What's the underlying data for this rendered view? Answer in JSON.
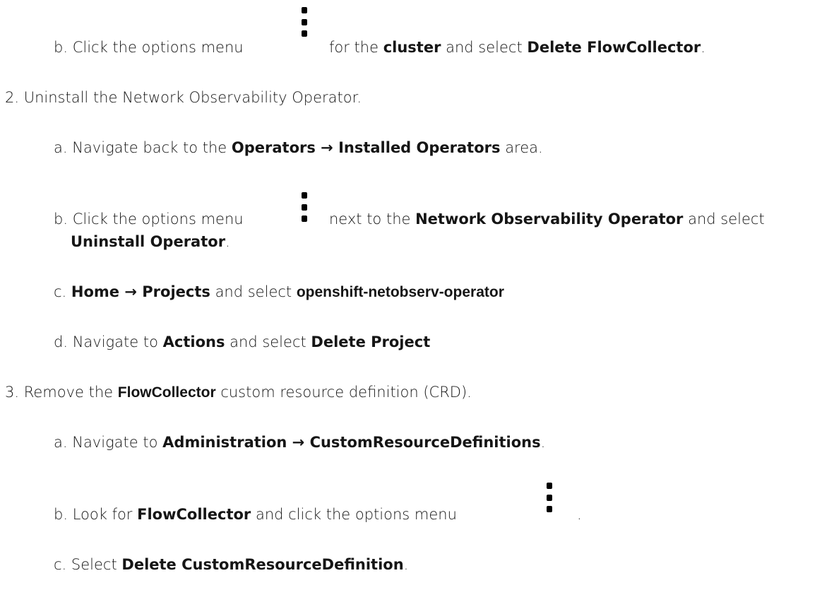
{
  "steps": {
    "s1b": {
      "marker": "b.",
      "t1": "Click the options menu",
      "t2": "for the",
      "b1": "cluster",
      "t3": "and select",
      "b2": "Delete FlowCollector",
      "t4": "."
    },
    "s2": {
      "marker": "2.",
      "text": "Uninstall the Network Observability Operator."
    },
    "s2a": {
      "marker": "a.",
      "t1": "Navigate back to the",
      "b1": "Operators → Installed Operators",
      "t2": "area."
    },
    "s2b": {
      "marker": "b.",
      "t1": "Click the options menu",
      "t2": "next to the",
      "b1": "Network Observability Operator",
      "t3": "and select",
      "b2": "Uninstall Operator",
      "t4": "."
    },
    "s2c": {
      "marker": "c.",
      "b1": "Home → Projects",
      "t1": "and select",
      "b2": "openshift-netobserv-operator"
    },
    "s2d": {
      "marker": "d.",
      "t1": "Navigate to",
      "b1": "Actions",
      "t2": "and select",
      "b2": "Delete Project"
    },
    "s3": {
      "marker": "3.",
      "t1": "Remove the",
      "b1": "FlowCollector",
      "t2": "custom resource definition (CRD)."
    },
    "s3a": {
      "marker": "a.",
      "t1": "Navigate to",
      "b1": "Administration → CustomResourceDefinitions",
      "t2": "."
    },
    "s3b": {
      "marker": "b.",
      "t1": "Look for",
      "b1": "FlowCollector",
      "t2": "and click the options menu",
      "t3": "."
    },
    "s3c": {
      "marker": "c.",
      "t1": "Select",
      "b1": "Delete CustomResourceDefinition",
      "t2": "."
    }
  },
  "icons": {
    "options_menu": "kebab-vertical-icon"
  }
}
